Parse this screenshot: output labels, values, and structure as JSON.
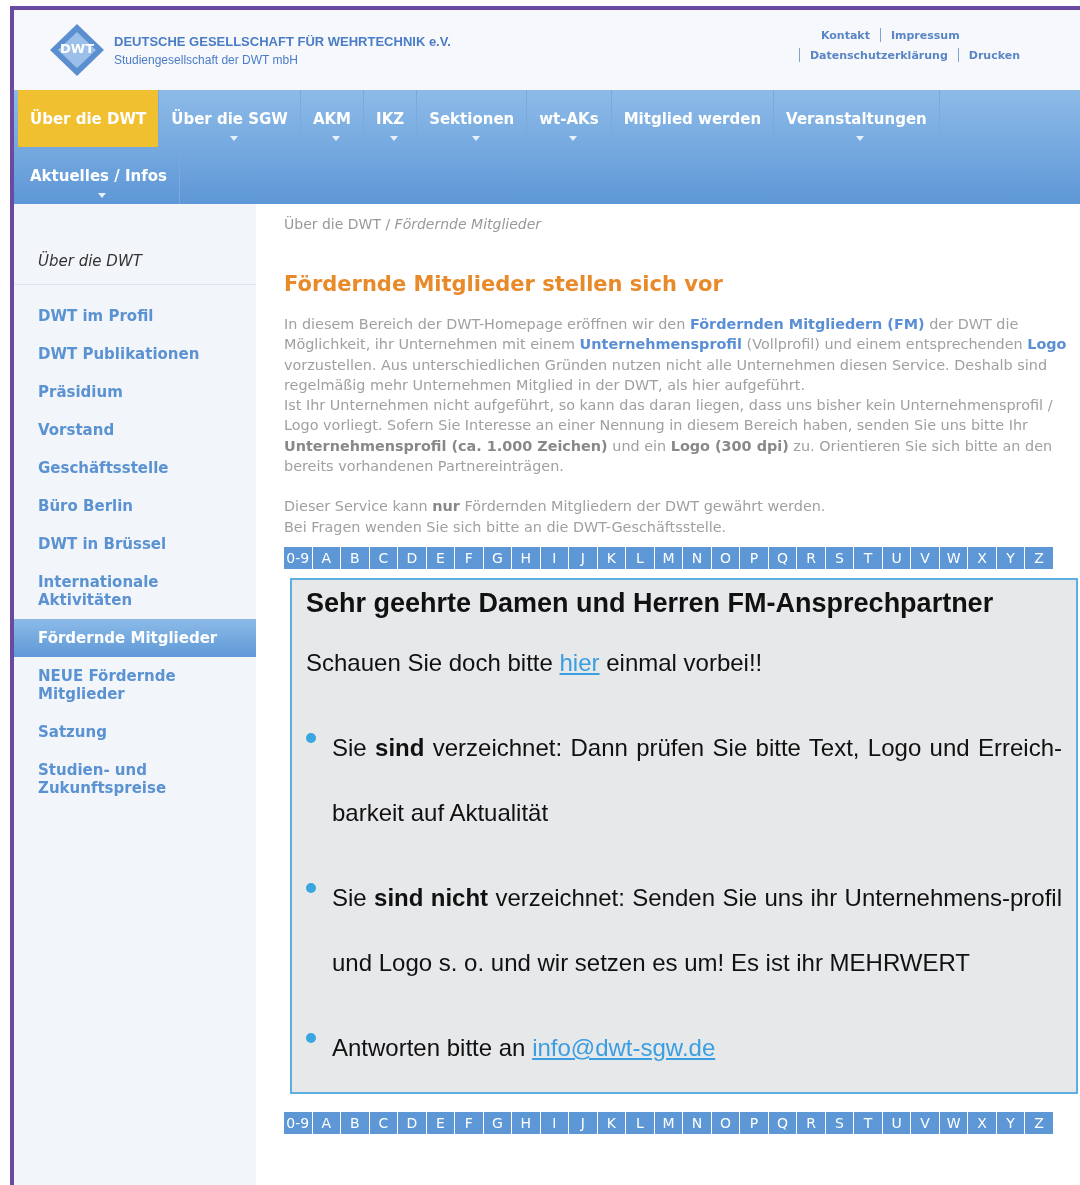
{
  "header": {
    "org_name": "DEUTSCHE GESELLSCHAFT FÜR WEHRTECHNIK e.V.",
    "org_sub": "Studiengesellschaft der DWT mbH",
    "logo_text": "DWT",
    "links": [
      [
        "Kontakt",
        "Impressum"
      ],
      [
        "Datenschutzerklärung",
        "Drucken"
      ]
    ]
  },
  "nav": [
    {
      "label": "Über die DWT",
      "selected": true,
      "dropdown": false
    },
    {
      "label": "Über die SGW",
      "selected": false,
      "dropdown": true
    },
    {
      "label": "AKM",
      "selected": false,
      "dropdown": true
    },
    {
      "label": "IKZ",
      "selected": false,
      "dropdown": true
    },
    {
      "label": "Sektionen",
      "selected": false,
      "dropdown": true
    },
    {
      "label": "wt-AKs",
      "selected": false,
      "dropdown": true
    },
    {
      "label": "Mitglied werden",
      "selected": false,
      "dropdown": false
    },
    {
      "label": "Veranstaltungen",
      "selected": false,
      "dropdown": true
    },
    {
      "label": "Aktuelles / Infos",
      "selected": false,
      "dropdown": true
    }
  ],
  "sidebar": {
    "title": "Über die DWT",
    "items": [
      {
        "label": "DWT im Profil",
        "selected": false
      },
      {
        "label": "DWT Publikationen",
        "selected": false
      },
      {
        "label": "Präsidium",
        "selected": false
      },
      {
        "label": "Vorstand",
        "selected": false
      },
      {
        "label": "Geschäftsstelle",
        "selected": false
      },
      {
        "label": "Büro Berlin",
        "selected": false
      },
      {
        "label": "DWT in Brüssel",
        "selected": false
      },
      {
        "label": "Internationale Aktivitäten",
        "selected": false
      },
      {
        "label": "Fördernde Mitglieder",
        "selected": true
      },
      {
        "label": "NEUE Fördernde Mitglieder",
        "selected": false
      },
      {
        "label": "Satzung",
        "selected": false
      },
      {
        "label": "Studien- und Zukunftspreise",
        "selected": false
      }
    ]
  },
  "breadcrumb": "Über die DWT / *Fördernde Mitglieder*",
  "heading": "Fördernde Mitglieder stellen sich vor",
  "paragraphs": [
    {
      "kind": "blue",
      "text": "In diesem Bereich der DWT-Homepage eröffnen wir den **Fördernden Mitgliedern (FM)** der DWT die Möglichkeit, ihr Unternehmen mit einem **Unternehmensprofil** (Vollprofil) und einem entsprechenden **Logo** vorzustellen. Aus unterschiedlichen Gründen nutzen nicht alle Unternehmen diesen Service. Deshalb sind regelmäßig mehr Unternehmen Mitglied in der DWT, als hier aufgeführt."
    },
    {
      "kind": "plain",
      "text": "Ist Ihr Unternehmen nicht aufgeführt, so kann das daran liegen, dass uns bisher kein Unternehmensprofil / Logo vorliegt. Sofern Sie Interesse an einer Nennung in diesem Bereich haben, senden Sie uns bitte Ihr **Unternehmensprofil (ca. 1.000 Zeichen)** und ein **Logo (300 dpi)** zu. Orientieren Sie sich bitte an den bereits vorhandenen Partnereinträgen."
    },
    {
      "kind": "gap",
      "text": "Dieser Service kann **nur** Fördernden Mitgliedern der DWT gewährt werden."
    },
    {
      "kind": "plain",
      "text": "Bei Fragen wenden Sie sich bitte an die DWT-Geschäftsstelle."
    }
  ],
  "alphabet_top": [
    "0-9",
    "A",
    "B",
    "C",
    "D",
    "E",
    "F",
    "G",
    "H",
    "I",
    "J",
    "K",
    "L",
    "M",
    "N",
    "O",
    "P",
    "Q",
    "R",
    "S",
    "T",
    "U",
    "V",
    "W",
    "X",
    "Y",
    "Z"
  ],
  "notice": {
    "title": "Sehr geehrte Damen und Herren FM-Ansprechpartner",
    "intro_before": "Schauen Sie doch bitte",
    "intro_link": "hier",
    "intro_after": "einmal vorbei!!",
    "bullets": [
      {
        "text": "Sie **sind** verzeichnet: Dann prüfen Sie bitte Text, Logo und Erreich-barkeit auf Aktualität"
      },
      {
        "text": "Sie **sind nicht** verzeichnet: Senden Sie uns ihr Unternehmens-profil und Logo s. o. und wir setzen es um! Es ist ihr MEHRWERT"
      },
      {
        "text": "Antworten bitte an",
        "link": "info@dwt-sgw.de"
      }
    ]
  },
  "alphabet_bottom": [
    "0-9",
    "A",
    "B",
    "C",
    "D",
    "E",
    "F",
    "G",
    "H",
    "I",
    "J",
    "K",
    "L",
    "M",
    "N",
    "O",
    "P",
    "Q",
    "R",
    "S",
    "T",
    "U",
    "V",
    "W",
    "X",
    "Y",
    "Z"
  ]
}
